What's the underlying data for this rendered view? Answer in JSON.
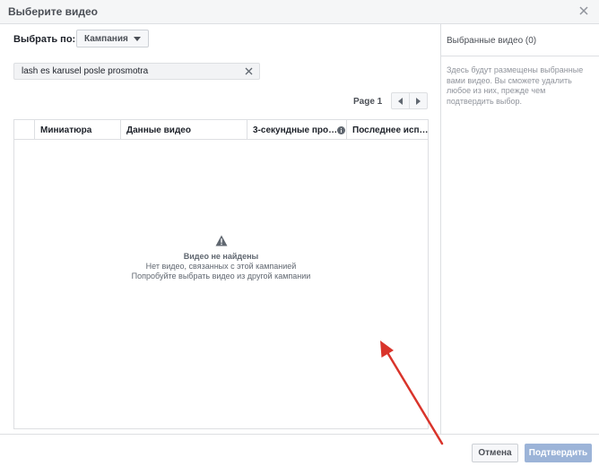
{
  "dialog": {
    "title": "Выберите видео"
  },
  "filter": {
    "label": "Выбрать по:",
    "dropdown_value": "Кампания"
  },
  "search": {
    "value": "lash es karusel posle prosmotra"
  },
  "pagination": {
    "label": "Page 1"
  },
  "table": {
    "columns": [
      "Миниатюра",
      "Данные видео",
      "3-секундные про…",
      "Последнее исп…"
    ]
  },
  "empty_state": {
    "icon": "warning-icon",
    "title": "Видео не найдены",
    "lines": [
      "Нет видео, связанных с этой кампанией",
      "Попробуйте выбрать видео из другой кампании"
    ]
  },
  "selected_panel": {
    "title": "Выбранные видео (0)",
    "hint": "Здесь будут размещены выбранные вами видео. Вы сможете удалить любое из них, прежде чем подтвердить выбор."
  },
  "footer": {
    "cancel_label": "Отмена",
    "confirm_label": "Подтвердить"
  },
  "colors": {
    "annotation_arrow": "#d9342b",
    "confirm_disabled": "#9cb4d8"
  }
}
